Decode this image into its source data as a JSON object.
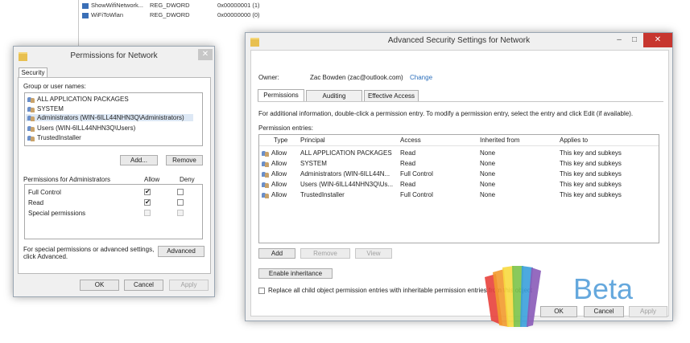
{
  "background_registry": {
    "rows": [
      {
        "name": "ShowWifiNetwork...",
        "type": "REG_DWORD",
        "data": "0x00000001 (1)"
      },
      {
        "name": "WiFiToWlan",
        "type": "REG_DWORD",
        "data": "0x00000000 (0)"
      }
    ]
  },
  "permissions_dialog": {
    "title": "Permissions for Network",
    "tab_security": "Security",
    "group_label": "Group or user names:",
    "groups": [
      "ALL APPLICATION PACKAGES",
      "SYSTEM",
      "Administrators (WIN-6ILL44NHN3Q\\Administrators)",
      "Users (WIN-6ILL44NHN3Q\\Users)",
      "TrustedInstaller"
    ],
    "add_label": "Add...",
    "remove_label": "Remove",
    "perm_header": "Permissions for Administrators",
    "allow_header": "Allow",
    "deny_header": "Deny",
    "perms": [
      {
        "name": "Full Control",
        "allow": "✔",
        "deny": ""
      },
      {
        "name": "Read",
        "allow": "✔",
        "deny": ""
      },
      {
        "name": "Special permissions",
        "allow": "",
        "deny": ""
      }
    ],
    "advanced_note_1": "For special permissions or advanced settings,",
    "advanced_note_2": "click Advanced.",
    "advanced_label": "Advanced",
    "ok_label": "OK",
    "cancel_label": "Cancel",
    "apply_label": "Apply"
  },
  "advanced_dialog": {
    "title": "Advanced Security Settings for Network",
    "minimize": "–",
    "maximize": "□",
    "close": "✕",
    "owner_label": "Owner:",
    "owner_value": "Zac Bowden (zac@outlook.com)",
    "change_label": "Change",
    "tabs": [
      "Permissions",
      "Auditing",
      "Effective Access"
    ],
    "info_text": "For additional information, double-click a permission entry. To modify a permission entry, select the entry and click Edit (if available).",
    "entries_label": "Permission entries:",
    "columns": [
      "Type",
      "Principal",
      "Access",
      "Inherited from",
      "Applies to"
    ],
    "rows": [
      {
        "type": "Allow",
        "principal": "ALL APPLICATION PACKAGES",
        "access": "Read",
        "inherited": "None",
        "applies": "This key and subkeys"
      },
      {
        "type": "Allow",
        "principal": "SYSTEM",
        "access": "Read",
        "inherited": "None",
        "applies": "This key and subkeys"
      },
      {
        "type": "Allow",
        "principal": "Administrators (WIN-6ILL44N...",
        "access": "Full Control",
        "inherited": "None",
        "applies": "This key and subkeys"
      },
      {
        "type": "Allow",
        "principal": "Users (WIN-6ILL44NHN3Q\\Us...",
        "access": "Read",
        "inherited": "None",
        "applies": "This key and subkeys"
      },
      {
        "type": "Allow",
        "principal": "TrustedInstaller",
        "access": "Full Control",
        "inherited": "None",
        "applies": "This key and subkeys"
      }
    ],
    "add_label": "Add",
    "remove_label": "Remove",
    "view_label": "View",
    "enable_inheritance_label": "Enable inheritance",
    "replace_label": "Replace all child object permission entries with inheritable permission entries from this object",
    "ok_label": "OK",
    "cancel_label": "Cancel",
    "apply_label": "Apply"
  },
  "watermark": {
    "text": "Beta",
    "colors": [
      "#e8413c",
      "#f29a2e",
      "#f7d93f",
      "#7cc34a",
      "#3aa0dc",
      "#8a5bb8"
    ]
  }
}
